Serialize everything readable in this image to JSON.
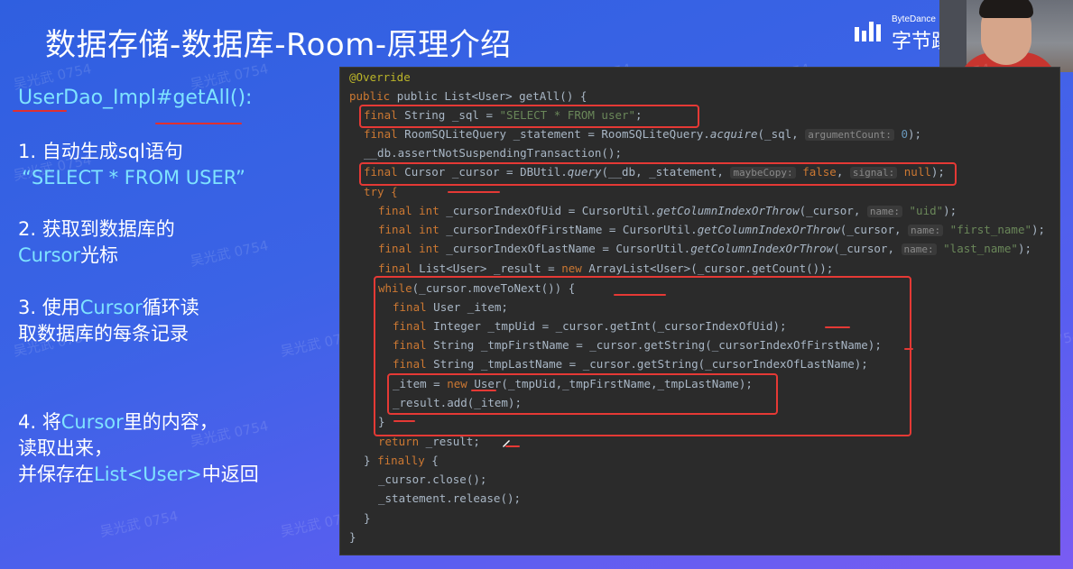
{
  "title": "数据存储-数据库-Room-原理介绍",
  "logo": {
    "brand": "ByteDance",
    "brand_cn": "字节跳"
  },
  "watermark": "吴光武 0754",
  "sidebar": {
    "heading": "UserDao_Impl#getAll():",
    "steps": [
      {
        "line1": "1. 自动生成sql语句",
        "line2": "“SELECT * FROM USER”"
      },
      {
        "line1": "2. 获取到数据库的",
        "line2_hl": "Cursor",
        "line2_rest": "光标"
      },
      {
        "line1_pre": "3. 使用",
        "line1_hl": "Cursor",
        "line1_rest": "循环读",
        "line2": "取数据库的每条记录"
      },
      {
        "line1_pre": "4. 将",
        "line1_hl": "Cursor",
        "line1_rest": "里的内容，",
        "line2": "读取出来，",
        "line3_pre": "并保存在",
        "line3_hl": "List<User>",
        "line3_rest": "中返回"
      }
    ]
  },
  "code": {
    "annotation": "@Override",
    "lines": {
      "sig": "public List<User> getAll() {",
      "sql_kw": "final",
      "sql_type": " String _sql = ",
      "sql_str": "\"SELECT * FROM user\"",
      "sql_end": ";",
      "stmt_a": "final",
      "stmt_b": " RoomSQLiteQuery _statement = RoomSQLiteQuery.",
      "stmt_fn": "acquire",
      "stmt_c": "(_sql, ",
      "stmt_hint": "argumentCount:",
      "stmt_num": " 0",
      "stmt_d": ");",
      "assert": "__db.assertNotSuspendingTransaction();",
      "cur_a": "final",
      "cur_b": " Cursor _cursor = DBUtil.",
      "cur_fn": "query",
      "cur_c": "(__db, _statement, ",
      "cur_hint1": "maybeCopy:",
      "cur_false": " false",
      "cur_d": ", ",
      "cur_hint2": "signal:",
      "cur_null": " null",
      "cur_e": ");",
      "try": "try {",
      "idx1_a": "final int",
      "idx1_b": " _cursorIndexOfUid = CursorUtil.",
      "idx1_fn": "getColumnIndexOrThrow",
      "idx1_c": "(_cursor, ",
      "idx1_hint": "name:",
      "idx1_str": " \"uid\"",
      "idx1_d": ");",
      "idx2_a": "final int",
      "idx2_b": " _cursorIndexOfFirstName = CursorUtil.",
      "idx2_fn": "getColumnIndexOrThrow",
      "idx2_c": "(_cursor, ",
      "idx2_hint": "name:",
      "idx2_str": " \"first_name\"",
      "idx2_d": ");",
      "idx3_a": "final int",
      "idx3_b": " _cursorIndexOfLastName = CursorUtil.",
      "idx3_fn": "getColumnIndexOrThrow",
      "idx3_c": "(_cursor, ",
      "idx3_hint": "name:",
      "idx3_str": " \"last_name\"",
      "idx3_d": ");",
      "res_a": "final",
      "res_b": " List<User> _result = ",
      "res_new": "new",
      "res_c": " ArrayList<User>(_cursor.getCount());",
      "while_kw": "while",
      "while_rest": "(_cursor.moveToNext()) {",
      "item_kw": "final",
      "item_rest": " User _item;",
      "uid_kw": "final",
      "uid_rest": " Integer _tmpUid = _cursor.getInt(_cursorIndexOfUid);",
      "fn_kw": "final",
      "fn_rest": " String _tmpFirstName = _cursor.getString(_cursorIndexOfFirstName);",
      "ln_kw": "final",
      "ln_rest": " String _tmpLastName = _cursor.getString(_cursorIndexOfLastName);",
      "new_a": "_item = ",
      "new_kw": "new",
      "new_rest": " User(_tmpUid,_tmpFirstName,_tmpLastName);",
      "add": "_result.add(_item);",
      "close_brace": "}",
      "ret_kw": "return",
      "ret_rest": " _result;",
      "finally_a": "} ",
      "finally_kw": "finally",
      "finally_b": " {",
      "close": "_cursor.close();",
      "release": "_statement.release();",
      "end1": "}",
      "end2": "}"
    }
  }
}
